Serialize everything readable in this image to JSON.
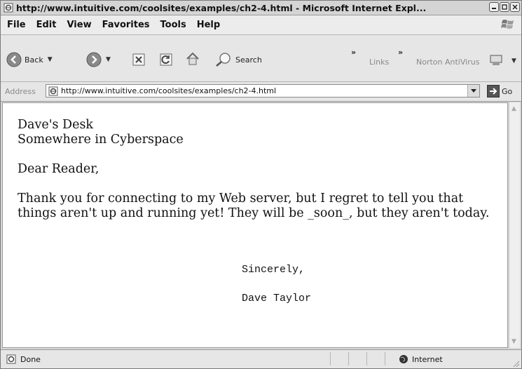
{
  "window": {
    "title": "http://www.intuitive.com/coolsites/examples/ch2-4.html - Microsoft Internet Expl..."
  },
  "menu": {
    "items": [
      "File",
      "Edit",
      "View",
      "Favorites",
      "Tools",
      "Help"
    ]
  },
  "toolbar": {
    "back_label": "Back",
    "search_label": "Search",
    "links_label": "Links",
    "norton_label": "Norton AntiVirus",
    "chevron": "»"
  },
  "address": {
    "label": "Address",
    "url": "http://www.intuitive.com/coolsites/examples/ch2-4.html",
    "go_label": "Go"
  },
  "page": {
    "heading_line1": "Dave's Desk",
    "heading_line2": "Somewhere in Cyberspace",
    "greeting": "Dear Reader,",
    "body": "Thank you for connecting to my Web server, but I regret to tell you that things aren't up and running yet! They will be _soon_, but they aren't today.",
    "closing": "Sincerely,",
    "signature": "Dave Taylor"
  },
  "status": {
    "text": "Done",
    "zone": "Internet"
  },
  "colors": {
    "chrome": "#e6e6e6",
    "content_bg": "#ffffff",
    "text": "#111111"
  }
}
